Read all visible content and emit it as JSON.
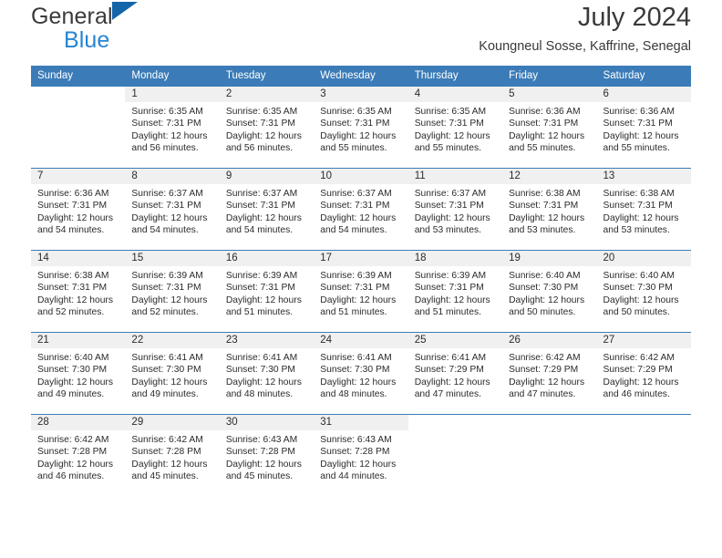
{
  "brand": {
    "name_top": "General",
    "name_bottom": "Blue",
    "triangle_color": "#1464aa",
    "blue_text_color": "#2585d3"
  },
  "header": {
    "title": "July 2024",
    "subtitle": "Koungneul Sosse, Kaffrine, Senegal"
  },
  "calendar": {
    "header_background": "#3b7cb8",
    "daynum_background": "#f0f0f0",
    "weekday_headers": [
      "Sunday",
      "Monday",
      "Tuesday",
      "Wednesday",
      "Thursday",
      "Friday",
      "Saturday"
    ],
    "weeks": [
      [
        {
          "day": "",
          "sunrise": "",
          "sunset": "",
          "daylight_line1": "",
          "daylight_line2": ""
        },
        {
          "day": "1",
          "sunrise": "Sunrise: 6:35 AM",
          "sunset": "Sunset: 7:31 PM",
          "daylight_line1": "Daylight: 12 hours",
          "daylight_line2": "and 56 minutes."
        },
        {
          "day": "2",
          "sunrise": "Sunrise: 6:35 AM",
          "sunset": "Sunset: 7:31 PM",
          "daylight_line1": "Daylight: 12 hours",
          "daylight_line2": "and 56 minutes."
        },
        {
          "day": "3",
          "sunrise": "Sunrise: 6:35 AM",
          "sunset": "Sunset: 7:31 PM",
          "daylight_line1": "Daylight: 12 hours",
          "daylight_line2": "and 55 minutes."
        },
        {
          "day": "4",
          "sunrise": "Sunrise: 6:35 AM",
          "sunset": "Sunset: 7:31 PM",
          "daylight_line1": "Daylight: 12 hours",
          "daylight_line2": "and 55 minutes."
        },
        {
          "day": "5",
          "sunrise": "Sunrise: 6:36 AM",
          "sunset": "Sunset: 7:31 PM",
          "daylight_line1": "Daylight: 12 hours",
          "daylight_line2": "and 55 minutes."
        },
        {
          "day": "6",
          "sunrise": "Sunrise: 6:36 AM",
          "sunset": "Sunset: 7:31 PM",
          "daylight_line1": "Daylight: 12 hours",
          "daylight_line2": "and 55 minutes."
        }
      ],
      [
        {
          "day": "7",
          "sunrise": "Sunrise: 6:36 AM",
          "sunset": "Sunset: 7:31 PM",
          "daylight_line1": "Daylight: 12 hours",
          "daylight_line2": "and 54 minutes."
        },
        {
          "day": "8",
          "sunrise": "Sunrise: 6:37 AM",
          "sunset": "Sunset: 7:31 PM",
          "daylight_line1": "Daylight: 12 hours",
          "daylight_line2": "and 54 minutes."
        },
        {
          "day": "9",
          "sunrise": "Sunrise: 6:37 AM",
          "sunset": "Sunset: 7:31 PM",
          "daylight_line1": "Daylight: 12 hours",
          "daylight_line2": "and 54 minutes."
        },
        {
          "day": "10",
          "sunrise": "Sunrise: 6:37 AM",
          "sunset": "Sunset: 7:31 PM",
          "daylight_line1": "Daylight: 12 hours",
          "daylight_line2": "and 54 minutes."
        },
        {
          "day": "11",
          "sunrise": "Sunrise: 6:37 AM",
          "sunset": "Sunset: 7:31 PM",
          "daylight_line1": "Daylight: 12 hours",
          "daylight_line2": "and 53 minutes."
        },
        {
          "day": "12",
          "sunrise": "Sunrise: 6:38 AM",
          "sunset": "Sunset: 7:31 PM",
          "daylight_line1": "Daylight: 12 hours",
          "daylight_line2": "and 53 minutes."
        },
        {
          "day": "13",
          "sunrise": "Sunrise: 6:38 AM",
          "sunset": "Sunset: 7:31 PM",
          "daylight_line1": "Daylight: 12 hours",
          "daylight_line2": "and 53 minutes."
        }
      ],
      [
        {
          "day": "14",
          "sunrise": "Sunrise: 6:38 AM",
          "sunset": "Sunset: 7:31 PM",
          "daylight_line1": "Daylight: 12 hours",
          "daylight_line2": "and 52 minutes."
        },
        {
          "day": "15",
          "sunrise": "Sunrise: 6:39 AM",
          "sunset": "Sunset: 7:31 PM",
          "daylight_line1": "Daylight: 12 hours",
          "daylight_line2": "and 52 minutes."
        },
        {
          "day": "16",
          "sunrise": "Sunrise: 6:39 AM",
          "sunset": "Sunset: 7:31 PM",
          "daylight_line1": "Daylight: 12 hours",
          "daylight_line2": "and 51 minutes."
        },
        {
          "day": "17",
          "sunrise": "Sunrise: 6:39 AM",
          "sunset": "Sunset: 7:31 PM",
          "daylight_line1": "Daylight: 12 hours",
          "daylight_line2": "and 51 minutes."
        },
        {
          "day": "18",
          "sunrise": "Sunrise: 6:39 AM",
          "sunset": "Sunset: 7:31 PM",
          "daylight_line1": "Daylight: 12 hours",
          "daylight_line2": "and 51 minutes."
        },
        {
          "day": "19",
          "sunrise": "Sunrise: 6:40 AM",
          "sunset": "Sunset: 7:30 PM",
          "daylight_line1": "Daylight: 12 hours",
          "daylight_line2": "and 50 minutes."
        },
        {
          "day": "20",
          "sunrise": "Sunrise: 6:40 AM",
          "sunset": "Sunset: 7:30 PM",
          "daylight_line1": "Daylight: 12 hours",
          "daylight_line2": "and 50 minutes."
        }
      ],
      [
        {
          "day": "21",
          "sunrise": "Sunrise: 6:40 AM",
          "sunset": "Sunset: 7:30 PM",
          "daylight_line1": "Daylight: 12 hours",
          "daylight_line2": "and 49 minutes."
        },
        {
          "day": "22",
          "sunrise": "Sunrise: 6:41 AM",
          "sunset": "Sunset: 7:30 PM",
          "daylight_line1": "Daylight: 12 hours",
          "daylight_line2": "and 49 minutes."
        },
        {
          "day": "23",
          "sunrise": "Sunrise: 6:41 AM",
          "sunset": "Sunset: 7:30 PM",
          "daylight_line1": "Daylight: 12 hours",
          "daylight_line2": "and 48 minutes."
        },
        {
          "day": "24",
          "sunrise": "Sunrise: 6:41 AM",
          "sunset": "Sunset: 7:30 PM",
          "daylight_line1": "Daylight: 12 hours",
          "daylight_line2": "and 48 minutes."
        },
        {
          "day": "25",
          "sunrise": "Sunrise: 6:41 AM",
          "sunset": "Sunset: 7:29 PM",
          "daylight_line1": "Daylight: 12 hours",
          "daylight_line2": "and 47 minutes."
        },
        {
          "day": "26",
          "sunrise": "Sunrise: 6:42 AM",
          "sunset": "Sunset: 7:29 PM",
          "daylight_line1": "Daylight: 12 hours",
          "daylight_line2": "and 47 minutes."
        },
        {
          "day": "27",
          "sunrise": "Sunrise: 6:42 AM",
          "sunset": "Sunset: 7:29 PM",
          "daylight_line1": "Daylight: 12 hours",
          "daylight_line2": "and 46 minutes."
        }
      ],
      [
        {
          "day": "28",
          "sunrise": "Sunrise: 6:42 AM",
          "sunset": "Sunset: 7:28 PM",
          "daylight_line1": "Daylight: 12 hours",
          "daylight_line2": "and 46 minutes."
        },
        {
          "day": "29",
          "sunrise": "Sunrise: 6:42 AM",
          "sunset": "Sunset: 7:28 PM",
          "daylight_line1": "Daylight: 12 hours",
          "daylight_line2": "and 45 minutes."
        },
        {
          "day": "30",
          "sunrise": "Sunrise: 6:43 AM",
          "sunset": "Sunset: 7:28 PM",
          "daylight_line1": "Daylight: 12 hours",
          "daylight_line2": "and 45 minutes."
        },
        {
          "day": "31",
          "sunrise": "Sunrise: 6:43 AM",
          "sunset": "Sunset: 7:28 PM",
          "daylight_line1": "Daylight: 12 hours",
          "daylight_line2": "and 44 minutes."
        },
        {
          "day": "",
          "sunrise": "",
          "sunset": "",
          "daylight_line1": "",
          "daylight_line2": ""
        },
        {
          "day": "",
          "sunrise": "",
          "sunset": "",
          "daylight_line1": "",
          "daylight_line2": ""
        },
        {
          "day": "",
          "sunrise": "",
          "sunset": "",
          "daylight_line1": "",
          "daylight_line2": ""
        }
      ]
    ]
  }
}
